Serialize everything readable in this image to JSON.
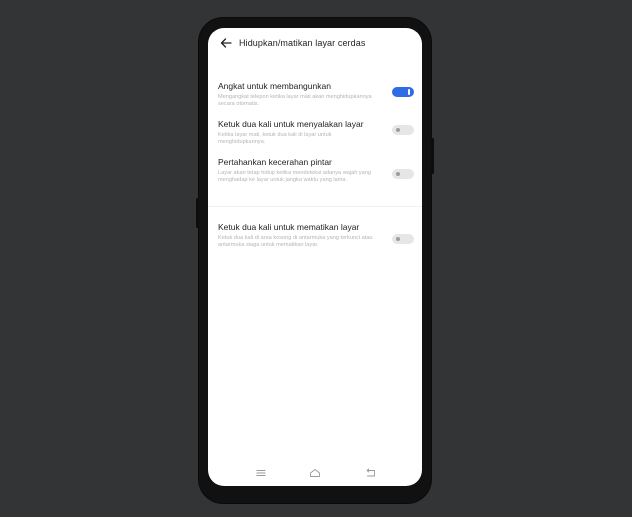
{
  "header": {
    "back_icon": "arrow-left-icon",
    "title": "Hidupkan/matikan layar cerdas"
  },
  "settings": [
    {
      "title": "Angkat untuk membangunkan",
      "description": "Mengangkat telepon ketika layar mati akan menghidupkannya secara otomatis.",
      "enabled": true
    },
    {
      "title": "Ketuk dua kali untuk menyalakan layar",
      "description": "Ketika layar mati, ketuk dua kali di layar untuk menghidupkannya.",
      "enabled": false
    },
    {
      "title": "Pertahankan kecerahan pintar",
      "description": "Layar akan tetap hidup ketika mendeteksi adanya wajah yang menghadap ke layar untuk jangka waktu yang lama.",
      "enabled": false
    },
    {
      "title": "Ketuk dua kali untuk mematikan layar",
      "description": "Ketuk dua kali di area kosong di antarmuka yang terkunci atau antarmuka siaga untuk mematikan layar.",
      "enabled": false
    }
  ],
  "navbar": {
    "menu_icon": "menu-icon",
    "home_icon": "home-icon",
    "back_icon": "back-icon"
  },
  "colors": {
    "accent": "#2f6ce5",
    "background": "#333435",
    "screen": "#ffffff"
  }
}
